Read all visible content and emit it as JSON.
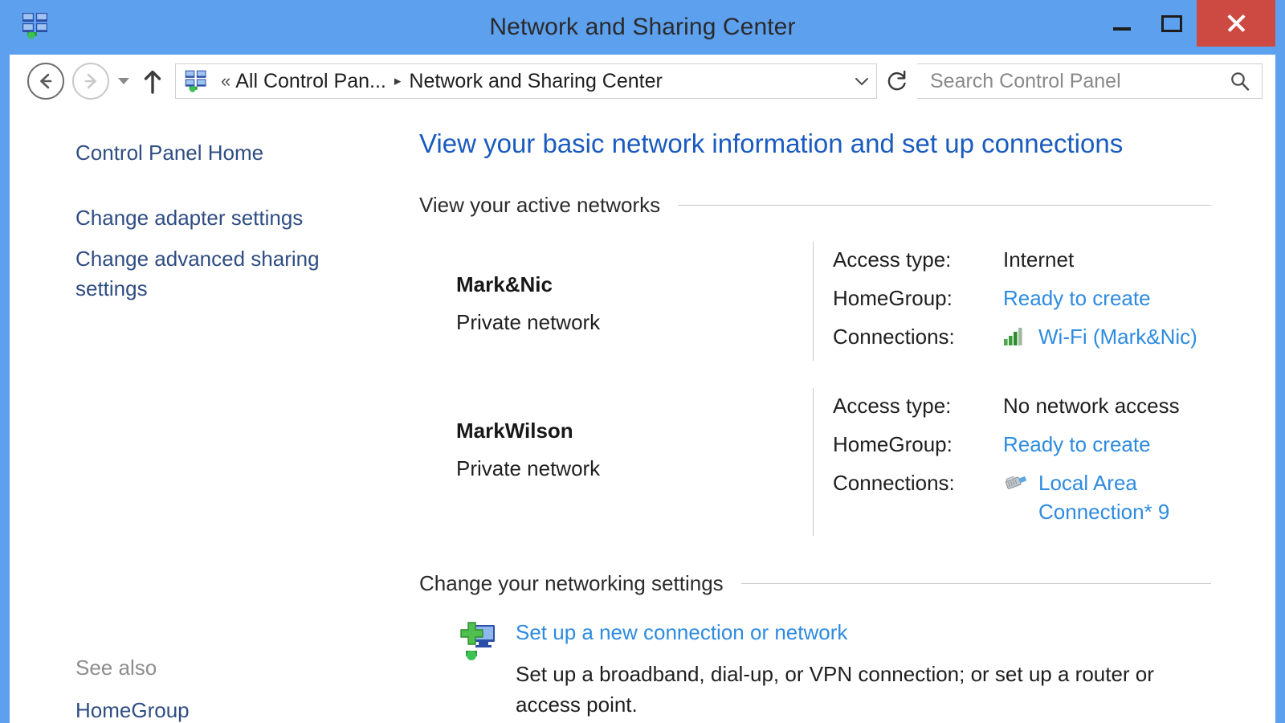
{
  "window": {
    "title": "Network and Sharing Center",
    "app_icon": "network-monitors-icon",
    "controls": {
      "minimize": "minimize-button",
      "maximize": "maximize-button",
      "close": "close-button"
    },
    "accent_titlebar": "#5CA0EE",
    "close_button_color": "#CD4A42"
  },
  "navbar": {
    "back": "back-button",
    "forward": "forward-button",
    "recent_dropdown": "recent-locations-dropdown",
    "up": "up-one-level-button",
    "breadcrumb": {
      "icon": "network-monitors-icon",
      "leading_chevron": "«",
      "items": [
        {
          "label": "All Control Pan...",
          "separator": "▸"
        },
        {
          "label": "Network and Sharing Center",
          "separator": ""
        }
      ],
      "dropdown_caret": "⌄"
    },
    "refresh": "refresh-button",
    "search": {
      "placeholder": "Search Control Panel",
      "value": "",
      "icon": "search-icon"
    }
  },
  "sidebar": {
    "items": [
      {
        "label": "Control Panel Home"
      },
      {
        "label": "Change adapter settings"
      },
      {
        "label": "Change advanced sharing settings"
      }
    ],
    "see_also": {
      "label": "See also",
      "links": [
        {
          "label": "HomeGroup"
        }
      ]
    },
    "link_color": "#2F4D82"
  },
  "main": {
    "heading": "View your basic network information and set up connections",
    "heading_color": "#1A5BBF",
    "active_networks": {
      "section_title": "View your active networks",
      "networks": [
        {
          "name": "Mark&Nic",
          "type": "Private network",
          "details": [
            {
              "label": "Access type:",
              "value": "Internet",
              "is_link": false,
              "icon": ""
            },
            {
              "label": "HomeGroup:",
              "value": "Ready to create",
              "is_link": true,
              "icon": ""
            },
            {
              "label": "Connections:",
              "value": "Wi-Fi (Mark&Nic)",
              "is_link": true,
              "icon": "wifi-signal-icon"
            }
          ]
        },
        {
          "name": "MarkWilson",
          "type": "Private network",
          "details": [
            {
              "label": "Access type:",
              "value": "No network access",
              "is_link": false,
              "icon": ""
            },
            {
              "label": "HomeGroup:",
              "value": "Ready to create",
              "is_link": true,
              "icon": ""
            },
            {
              "label": "Connections:",
              "value": "Local Area Connection* 9",
              "is_link": true,
              "icon": "ethernet-cable-icon"
            }
          ]
        }
      ]
    },
    "networking_settings": {
      "section_title": "Change your networking settings",
      "items": [
        {
          "icon": "new-connection-icon",
          "link": "Set up a new connection or network",
          "description": "Set up a broadband, dial-up, or VPN connection; or set up a router or access point."
        }
      ]
    },
    "link_color": "#2E8BE0"
  }
}
